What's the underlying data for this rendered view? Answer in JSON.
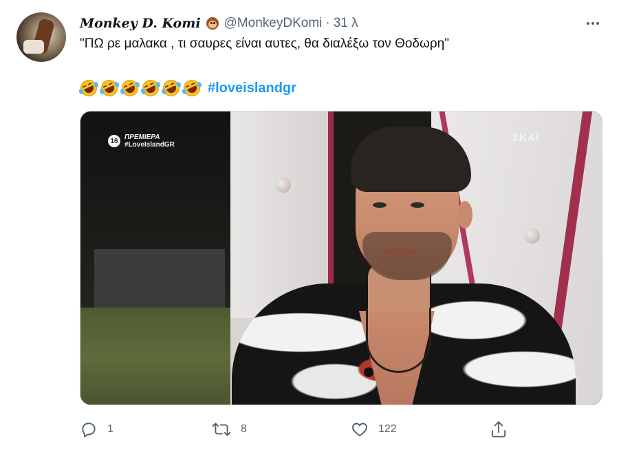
{
  "tweet": {
    "display_name": "Monkey D. Komi",
    "name_emoji": "monkey-face-icon",
    "handle": "@MonkeyDKomi",
    "separator": "·",
    "time": "31 λ",
    "text": "\"ΠΩ ρε μαλακα , τι σαυρες είναι αυτες, θα διαλέξω τον Θοδωρη\"",
    "emoji": "rolling-on-floor-laughing-icon",
    "emoji_count": 6,
    "hashtag": "#loveislandgr"
  },
  "media": {
    "badge_rating": "16",
    "badge_line1": "ΠΡΕΜΙΕΡΑ",
    "badge_line2": "#LoveIslandGR",
    "channel_logo": "ΣΚΑΪ"
  },
  "actions": {
    "reply_count": "1",
    "retweet_count": "8",
    "like_count": "122"
  },
  "colors": {
    "text": "#0f1419",
    "secondary": "#536471",
    "link": "#1d9bf0"
  }
}
